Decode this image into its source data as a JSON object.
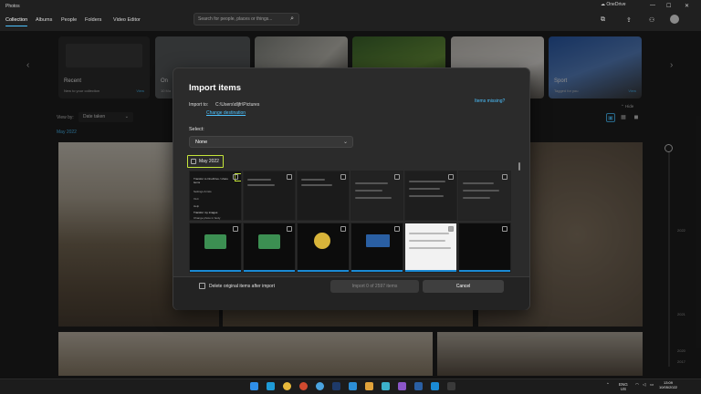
{
  "app": {
    "title": "Photos",
    "onedrive": "OneDrive"
  },
  "nav": {
    "tabs": [
      "Collection",
      "Albums",
      "People",
      "Folders",
      "Video Editor"
    ],
    "active": "Collection"
  },
  "search": {
    "placeholder": "Search for people, places or things..."
  },
  "carousel": {
    "cards": [
      {
        "label": "Recent",
        "sub": "New to your collection",
        "view": "View"
      },
      {
        "label": "On",
        "sub": "10 Ma",
        "view": ""
      },
      {
        "label": "Sport",
        "sub": "Tagged for you",
        "view": "View"
      }
    ]
  },
  "toolbar": {
    "view_by_label": "View by:",
    "view_by_value": "Date taken",
    "hide": "Hide"
  },
  "gallery": {
    "date_header": "May 2022"
  },
  "timeline": {
    "labels": [
      "2022",
      "2021",
      "2020",
      "2017"
    ]
  },
  "dialog": {
    "title": "Import items",
    "import_to_label": "Import to:",
    "import_path": "C:\\Users\\dljfr\\Pictures",
    "change_destination": "Change destination",
    "items_missing": "Items missing?",
    "select_label": "Select:",
    "select_value": "None",
    "group_label": "May 2022",
    "thumb_texts": [
      "Transfer to OneDrive / share items",
      "Settings & lists",
      "VLC",
      "Help",
      "Transfer my images",
      "Change photo in body"
    ],
    "delete_label": "Delete original items after import",
    "import_button": "Import 0 of 2597 items",
    "cancel_button": "Cancel"
  },
  "tray": {
    "lang": "ENG",
    "region": "US",
    "time": "13:09",
    "date": "10/05/2022"
  },
  "colors": {
    "accent": "#4cc2ff",
    "highlight": "#c5e53a",
    "dialog_bg": "#2b2b2b"
  }
}
